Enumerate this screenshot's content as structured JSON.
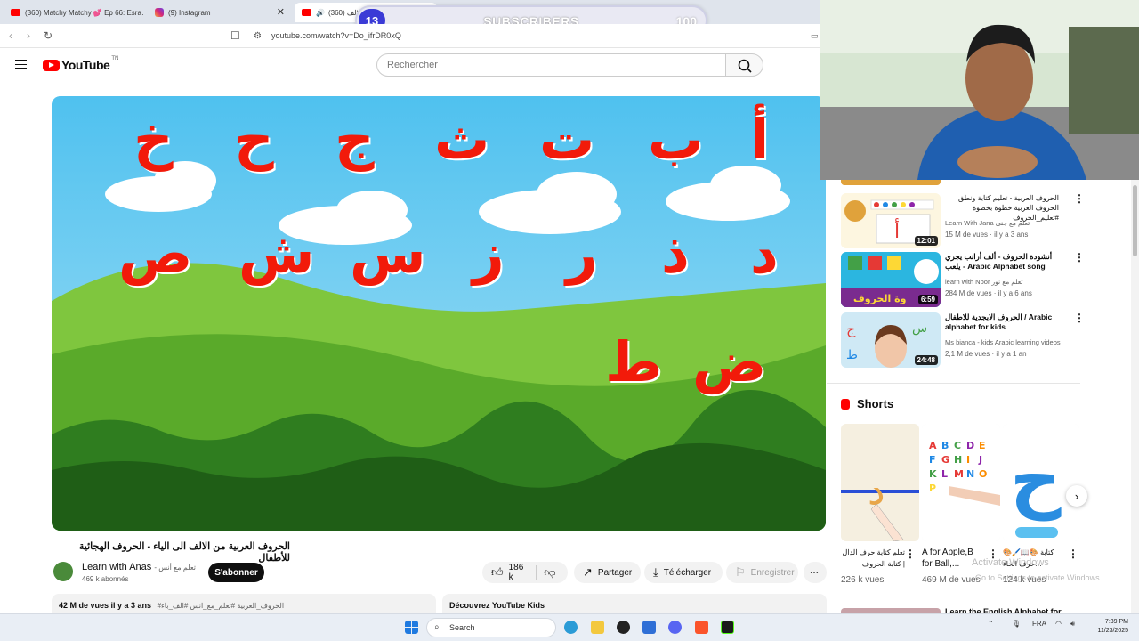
{
  "browser": {
    "tabs": [
      {
        "label": "(360) Matchy Matchy 💕 Ep 66: Esra…",
        "active": false
      },
      {
        "label": "(9) Instagram",
        "active": false
      },
      {
        "label": "(360) الحروف العربية من الالف…",
        "active": true
      }
    ],
    "new_tab": "+",
    "url": "youtube.com/watch?v=Do_ifrDR0xQ"
  },
  "overlay": {
    "count": "13",
    "label": "SUBSCRIBERS",
    "goal": "100"
  },
  "youtube": {
    "logo_text": "YouTube",
    "country_code": "TN",
    "search_placeholder": "Rechercher"
  },
  "video": {
    "letters": [
      [
        "أ",
        "ب",
        "ت",
        "ث",
        "ج",
        "ح",
        "خ"
      ],
      [
        "د",
        "ذ",
        "ر",
        "ز",
        "س",
        "ش",
        "ص"
      ],
      [
        "ض",
        "ط"
      ]
    ],
    "title": "الحروف العربية من الالف الى الياء - الحروف الهجائية للأطفال",
    "channel": "Learn with Anas",
    "channel_ar": "- تعلم مع أنس",
    "subscribers": "469 k abonnés",
    "subscribe": "S'abonner",
    "likes": "186 k",
    "share": "Partager",
    "download": "Télécharger",
    "save": "Enregistrer",
    "views_date": "42 M de vues  il y a 3 ans",
    "hashtags": "#الحروف_العربية #تعلم_مع_انس #الف_باء",
    "kids": "Découvrez YouTube Kids"
  },
  "sidebar": {
    "items": [
      {
        "title": "الحروف العربية - تعليم كتابة ونطق الحروف العربية خطوة بخطوة #تعليم_الحروف",
        "channel": "Learn With Jana تعلم مع جنى",
        "meta": "15 M de vues · il y a 3 ans",
        "duration": "12:01"
      },
      {
        "title": "أنشودة الحروف - ألف أرانب يجري يلعب - Arabic Alphabet song",
        "channel": "learn with Noor تعلم مع نور",
        "meta": "284 M de vues · il y a 6 ans",
        "duration": "6:59"
      },
      {
        "title": "الحروف الابجدية للاطفال / Arabic alphabet for kids",
        "channel": "Ms bianca - kids Arabic learning videos",
        "meta": "2,1 M de vues · il y a 1 an",
        "duration": "24:48"
      }
    ],
    "shorts_heading": "Shorts",
    "shorts": [
      {
        "title": "تعلم كتابة حرف الدال | كتابة الحروف",
        "views": "226 k vues"
      },
      {
        "title": "A for Apple,B for Ball,...",
        "views": "469 M de vues"
      },
      {
        "title": "🎨🖌️📖🎨 كتابة حرف الحاء…",
        "views": "124 k vues"
      }
    ],
    "next_item_title": "Learn the English Alphabet for…"
  },
  "watermark": {
    "line1": "Activate Windows",
    "line2": "Go to Settings to activate Windows."
  },
  "taskbar": {
    "search": "Search",
    "lang": "FRA",
    "time": "7:39 PM",
    "date": "11/23/2025"
  }
}
